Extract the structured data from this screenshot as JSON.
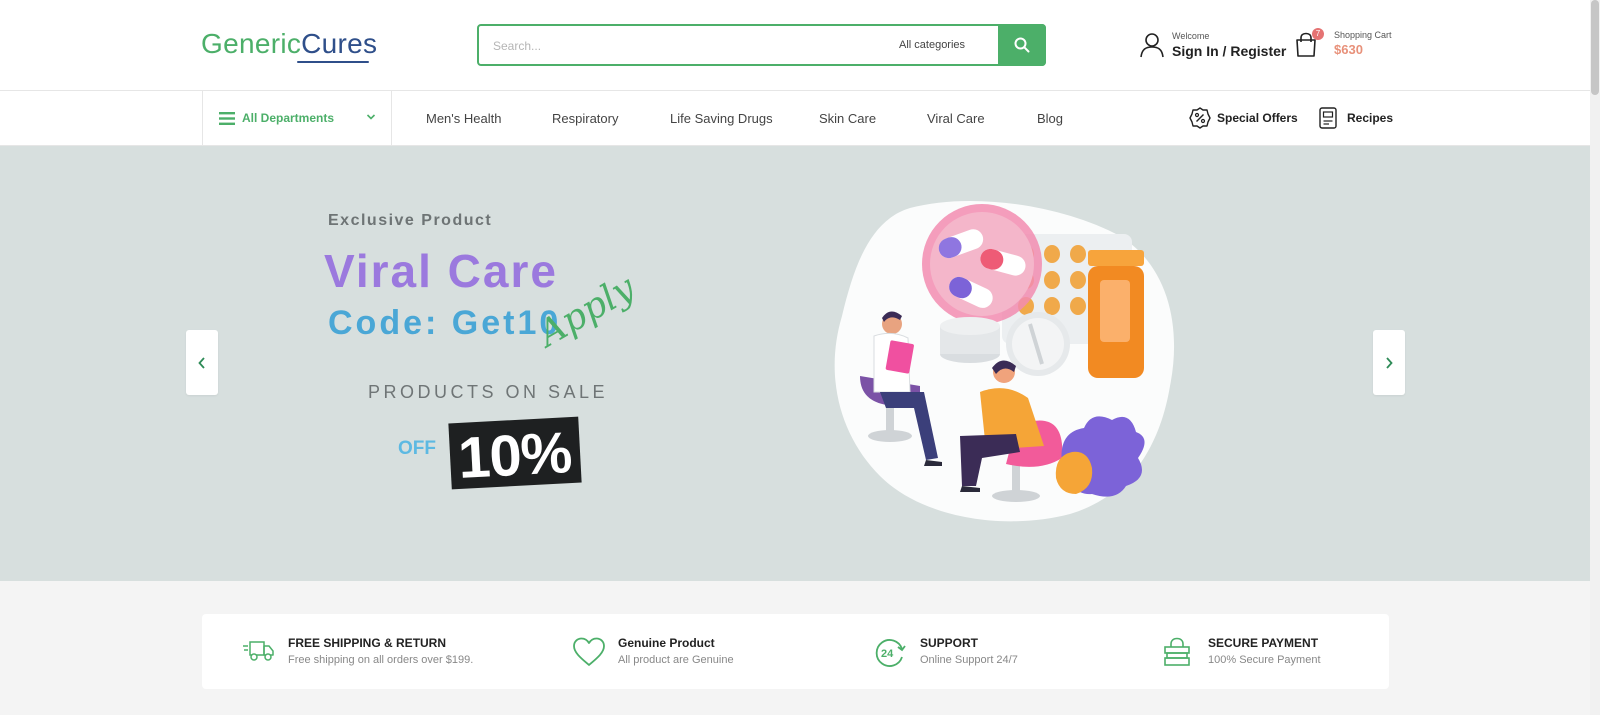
{
  "header": {
    "logo": {
      "part1": "Generic",
      "part2": "Cures"
    },
    "search": {
      "placeholder": "Search...",
      "category": "All categories"
    },
    "account": {
      "welcome": "Welcome",
      "signin": "Sign In / Register"
    },
    "cart": {
      "count": "7",
      "label": "Shopping Cart",
      "amount": "$630"
    }
  },
  "nav": {
    "departments": "All Departments",
    "links": [
      "Men's Health",
      "Respiratory",
      "Life Saving Drugs",
      "Skin Care",
      "Viral Care",
      "Blog"
    ],
    "special_offers": "Special Offers",
    "recipes": "Recipes"
  },
  "hero": {
    "eyebrow": "Exclusive Product",
    "title": "Viral Care",
    "code": "Code: Get10",
    "apply": "Apply",
    "on_sale": "PRODUCTS ON SALE",
    "off": "OFF",
    "percent": "10%"
  },
  "features": [
    {
      "title": "FREE SHIPPING & RETURN",
      "subtitle": "Free shipping on all orders over $199.",
      "icon": "truck-icon"
    },
    {
      "title": "Genuine Product",
      "subtitle": "All product are Genuine",
      "icon": "heart-icon"
    },
    {
      "title": "SUPPORT",
      "subtitle": "Online Support 24/7",
      "icon": "support-24-icon"
    },
    {
      "title": "SECURE PAYMENT",
      "subtitle": "100% Secure Payment",
      "icon": "secure-payment-icon"
    }
  ],
  "colors": {
    "brand_green": "#4caf69",
    "brand_blue": "#2f4f8a",
    "hero_bg": "#d7dfde",
    "title_purple": "#9b79de",
    "code_blue": "#4aa7d6",
    "cart_amount": "#e8917a"
  }
}
